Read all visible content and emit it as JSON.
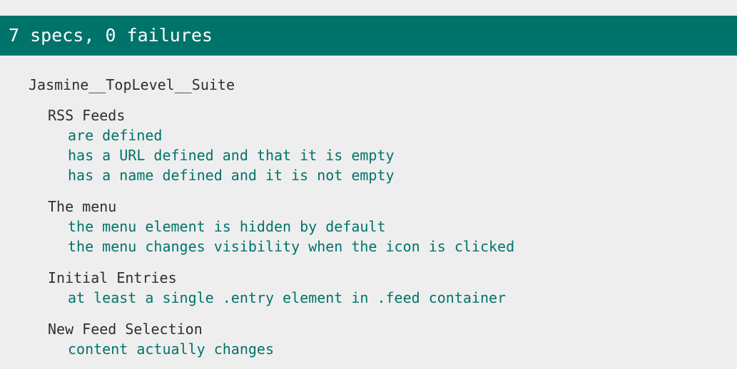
{
  "summary": "7 specs, 0 failures",
  "top_suite": "Jasmine__TopLevel__Suite",
  "suites": [
    {
      "title": "RSS Feeds",
      "specs": [
        "are defined",
        "has a URL defined and that it is empty",
        "has a name defined and it is not empty"
      ]
    },
    {
      "title": "The menu",
      "specs": [
        "the menu element is hidden by default",
        "the menu changes visibility when the icon is clicked"
      ]
    },
    {
      "title": "Initial Entries",
      "specs": [
        "at least a single .entry element in .feed container"
      ]
    },
    {
      "title": "New Feed Selection",
      "specs": [
        "content actually changes"
      ]
    }
  ],
  "colors": {
    "passed": "#00736a",
    "background": "#eeeeee",
    "text": "#2f2f2f"
  }
}
